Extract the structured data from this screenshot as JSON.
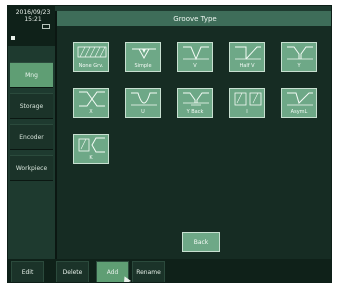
{
  "status": {
    "date": "2016/09/23",
    "time": "15:21"
  },
  "sidebar": {
    "items": [
      {
        "label": "Mng",
        "active": true
      },
      {
        "label": "Storage",
        "active": false
      },
      {
        "label": "Encoder",
        "active": false
      },
      {
        "label": "Workpiece",
        "active": false
      }
    ]
  },
  "panel": {
    "title": "Groove Type",
    "groove_types": [
      {
        "label": "None Grv.",
        "icon": "groove-none-icon"
      },
      {
        "label": "Simple",
        "icon": "groove-simple-icon"
      },
      {
        "label": "V",
        "icon": "groove-v-icon"
      },
      {
        "label": "Half V",
        "icon": "groove-half-v-icon"
      },
      {
        "label": "Y",
        "icon": "groove-y-icon"
      },
      {
        "label": "X",
        "icon": "groove-x-icon"
      },
      {
        "label": "U",
        "icon": "groove-u-icon"
      },
      {
        "label": "Y Back",
        "icon": "groove-y-back-icon"
      },
      {
        "label": "I",
        "icon": "groove-i-icon"
      },
      {
        "label": "AsymL",
        "icon": "groove-asym-l-icon"
      },
      {
        "label": "K",
        "icon": "groove-k-icon"
      }
    ],
    "back_label": "Back"
  },
  "toolbar": {
    "edit_label": "Edit",
    "delete_label": "Delete",
    "add_label": "Add",
    "rename_label": "Rename"
  },
  "colors": {
    "background": "#1e3a2f",
    "tile": "#6ea887",
    "active": "#5f9e74",
    "title_bar": "#3e6d59"
  }
}
